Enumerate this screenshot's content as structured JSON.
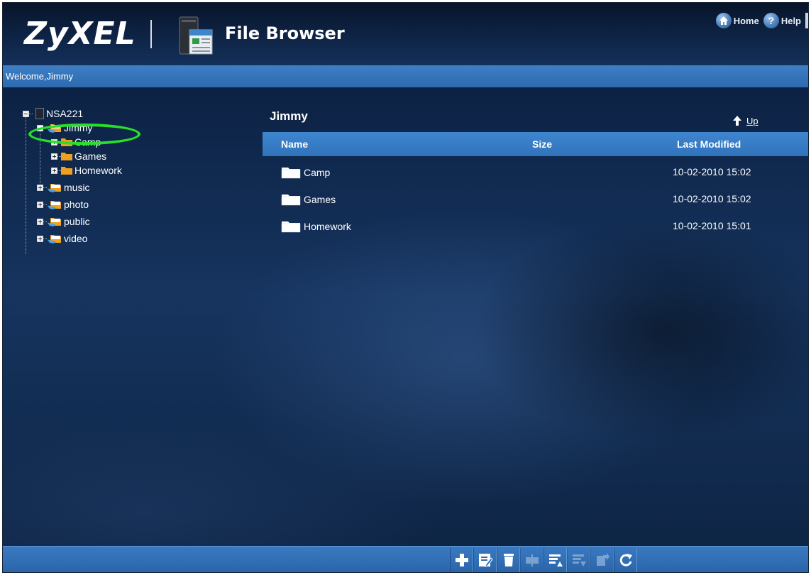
{
  "header": {
    "logo_text": "ZyXEL",
    "app_title": "File Browser",
    "links": [
      {
        "label": "Home",
        "icon": "home-icon"
      },
      {
        "label": "Help",
        "icon": "help-icon"
      }
    ]
  },
  "welcome_text": "Welcome,Jimmy",
  "tree": {
    "root": "NSA221",
    "selected": "Jimmy",
    "jimmy_children": [
      "Camp",
      "Games",
      "Homework"
    ],
    "shares": [
      "music",
      "photo",
      "public",
      "video"
    ]
  },
  "panel": {
    "current_folder": "Jimmy",
    "up_label": "Up",
    "columns": {
      "name": "Name",
      "size": "Size",
      "modified": "Last Modified"
    },
    "files": [
      {
        "name": "Camp",
        "size": "",
        "modified": "10-02-2010 15:02"
      },
      {
        "name": "Games",
        "size": "",
        "modified": "10-02-2010 15:02"
      },
      {
        "name": "Homework",
        "size": "",
        "modified": "10-02-2010 15:01"
      }
    ]
  },
  "toolbar": {
    "tools": [
      "add-icon",
      "rename-icon",
      "delete-icon",
      "move-icon",
      "upload-icon",
      "download-icon",
      "copy-icon",
      "refresh-icon"
    ]
  },
  "colors": {
    "accent_blue": "#2f73bb",
    "highlight_green": "#28e02a",
    "folder_orange": "#f0a020"
  }
}
